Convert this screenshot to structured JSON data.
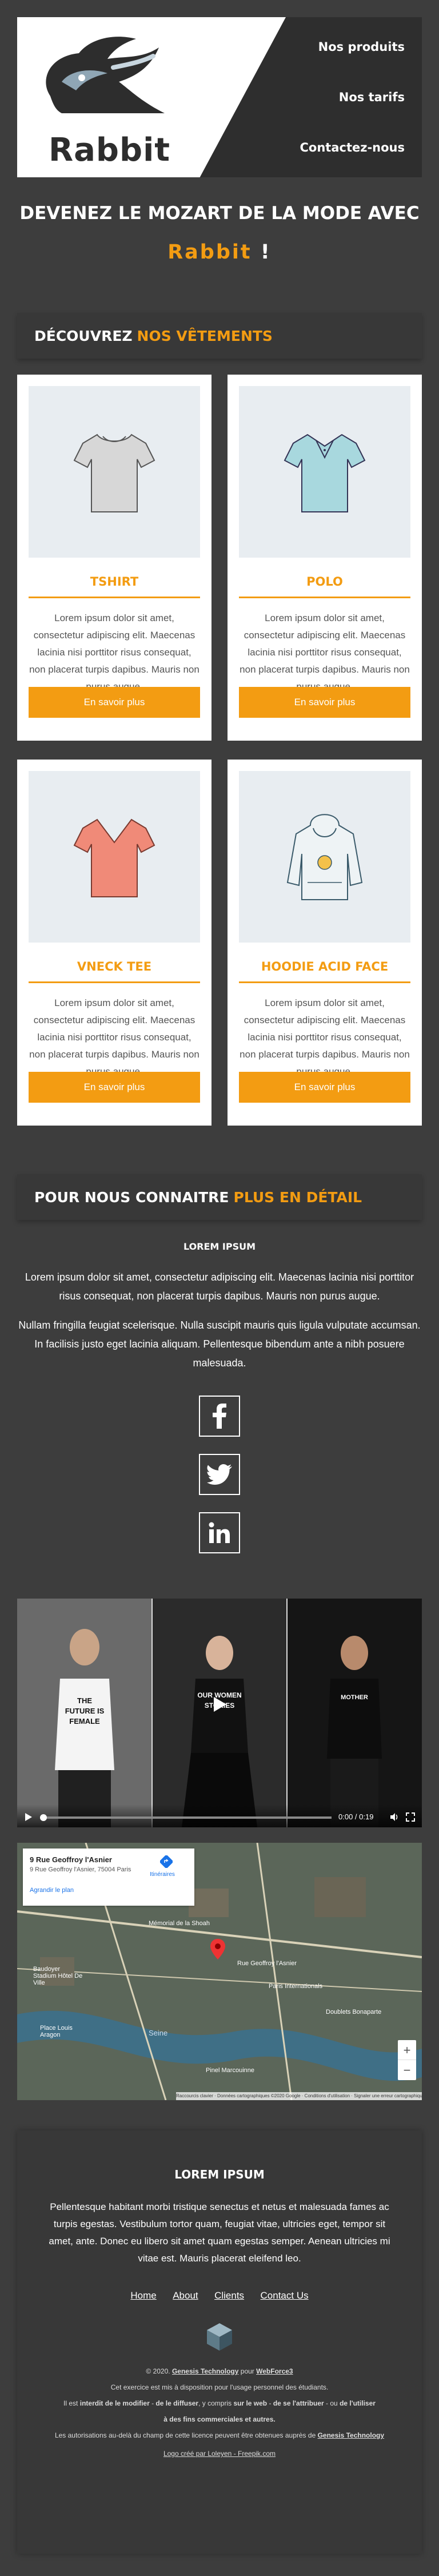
{
  "brand": {
    "name": "Rabbit"
  },
  "nav": [
    {
      "label": "Nos produits"
    },
    {
      "label": "Nos tarifs"
    },
    {
      "label": "Contactez-nous"
    }
  ],
  "hero": {
    "line1": "DEVENEZ LE MOZART DE LA MODE AVEC",
    "brand": "Rabbit",
    "exclaim": " !"
  },
  "products_section": {
    "title_prefix": "DÉCOUVREZ ",
    "title_highlight": "NOS VÊTEMENTS"
  },
  "products": [
    {
      "name": "TSHIRT",
      "image": "tshirt-gray",
      "text": "Lorem ipsum dolor sit amet, consectetur adipiscing elit. Maecenas lacinia nisi porttitor risus consequat, non placerat turpis dapibus. Mauris non purus augue.",
      "button": "En savoir plus"
    },
    {
      "name": "POLO",
      "image": "polo-cyan",
      "text": "Lorem ipsum dolor sit amet, consectetur adipiscing elit. Maecenas lacinia nisi porttitor risus consequat, non placerat turpis dapibus. Mauris non purus augue.",
      "button": "En savoir plus"
    },
    {
      "name": "VNECK TEE",
      "image": "vneck-salmon",
      "text": "Lorem ipsum dolor sit amet, consectetur adipiscing elit. Maecenas lacinia nisi porttitor risus consequat, non placerat turpis dapibus. Mauris non purus augue.",
      "button": "En savoir plus"
    },
    {
      "name": "HOODIE ACID FACE",
      "image": "hoodie-white",
      "text": "Lorem ipsum dolor sit amet, consectetur adipiscing elit. Maecenas lacinia nisi porttitor risus consequat, non placerat turpis dapibus. Mauris non purus augue.",
      "button": "En savoir plus"
    }
  ],
  "about_section": {
    "title_prefix": "POUR NOUS CONNAITRE ",
    "title_highlight": "PLUS EN DÉTAIL"
  },
  "about": {
    "subtitle": "LOREM IPSUM",
    "p1": "Lorem ipsum dolor sit amet, consectetur adipiscing elit. Maecenas lacinia nisi porttitor risus consequat, non placerat turpis dapibus. Mauris non purus augue.",
    "p2": "Nullam fringilla feugiat scelerisque. Nulla suscipit mauris quis ligula vulputate accumsan. In facilisis justo eget lacinia aliquam. Pellentesque bibendum ante a nibh posuere malesuada."
  },
  "social": [
    "facebook-icon",
    "twitter-icon",
    "linkedin-icon"
  ],
  "video": {
    "time": "0:00 / 0:19",
    "shirt_texts": [
      "THE FUTURE IS FEMALE",
      "OUR WOMEN STORIES",
      "MOTHER"
    ]
  },
  "map": {
    "address_title": "9 Rue Geoffroy l'Asnier",
    "address_line": "9 Rue Geoffroy l'Asnier, 75004 Paris",
    "directions": "Itinéraires",
    "enlarge": "Agrandir le plan",
    "labels": [
      "Mémorial de la Shoah",
      "Baudoyer Stadium Hôtel De Ville",
      "Place Louis Aragon",
      "Seine",
      "Pinel Marcouinne",
      "Rue Geoffroy l'Asnier",
      "Paris Internationals",
      "Doublets Bonaparte"
    ],
    "zoom_in": "+",
    "zoom_out": "−",
    "attribution": "Raccourcis clavier · Données cartographiques ©2020 Google · Conditions d'utilisation · Signaler une erreur cartographique"
  },
  "footer": {
    "title": "LOREM IPSUM",
    "text": "Pellentesque habitant morbi tristique senectus et netus et malesuada fames ac turpis egestas. Vestibulum tortor quam, feugiat vitae, ultricies eget, tempor sit amet, ante. Donec eu libero sit amet quam egestas semper. Aenean ultricies mi vitae est. Mauris placerat eleifend leo.",
    "links": [
      "Home",
      "About",
      "Clients",
      "Contact Us"
    ],
    "copyright_prefix": "© 2020. ",
    "copyright_company": "Genesis Technology",
    "copyright_mid": " pour ",
    "copyright_client": "WebForce3",
    "small1": "Cet exercice est mis à disposition pour l'usage personnel des étudiants.",
    "small2_a": "Il est ",
    "small2_b": "interdit de le modifier",
    "small2_c": " - ",
    "small2_d": "de le diffuser",
    "small2_e": ", y compris ",
    "small2_f": "sur le web",
    "small2_g": " - ",
    "small2_h": "de se l'attribuer",
    "small2_i": " - ou ",
    "small2_j": "de l'utiliser",
    "small3": "à des fins commerciales et autres.",
    "small4_a": "Les autorisations au-delà du champ de cette licence peuvent être obtenues auprès de ",
    "small4_b": "Genesis Technology",
    "small5": "Logo créé par Loleyen - Freepik.com"
  },
  "colors": {
    "accent": "#f39c12",
    "background": "#3d3d3d",
    "header": "#2e2e2e"
  }
}
